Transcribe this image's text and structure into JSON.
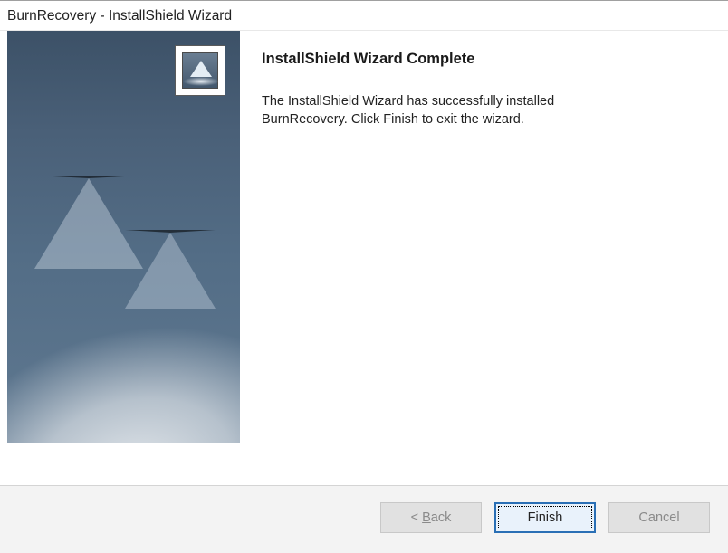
{
  "window": {
    "title": "BurnRecovery - InstallShield Wizard"
  },
  "main": {
    "heading": "InstallShield Wizard Complete",
    "body": "The InstallShield Wizard has successfully installed BurnRecovery.  Click Finish to exit the wizard."
  },
  "buttons": {
    "back_prefix": "< ",
    "back_hotkey": "B",
    "back_rest": "ack",
    "finish": "Finish",
    "cancel": "Cancel"
  },
  "state": {
    "back_enabled": false,
    "cancel_enabled": false,
    "finish_focused": true
  }
}
